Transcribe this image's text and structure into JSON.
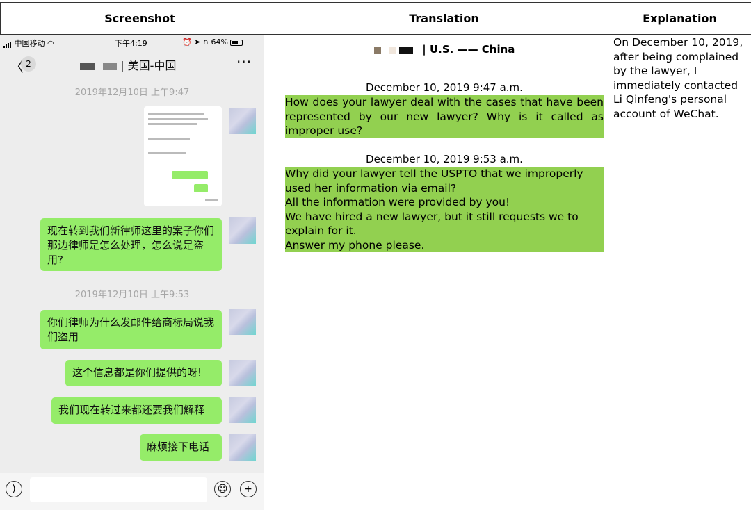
{
  "headers": {
    "screenshot": "Screenshot",
    "translation": "Translation",
    "explanation": "Explanation"
  },
  "phone": {
    "carrier": "中国移动",
    "time": "下午4:19",
    "battery": "64%",
    "back_count": "2",
    "chat_title": "| 美国-中国",
    "more": "···",
    "timestamp1": "2019年12月10日 上午9:47",
    "timestamp2": "2019年12月10日 上午9:53",
    "messages": [
      "现在转到我们新律师这里的案子你们那边律师是怎么处理，怎么说是盗用?",
      "你们律师为什么发邮件给商标局说我们盗用",
      "这个信息都是你们提供的呀!",
      "我们现在转过来都还要我们解释",
      "麻烦接下电话"
    ]
  },
  "translation": {
    "title": "| U.S. —— China",
    "date1": "December 10, 2019    9:47 a.m.",
    "block1": "How does your lawyer deal with the cases that have been represented by our new lawyer? Why is it called as improper use?",
    "date2": "December 10, 2019    9:53 a.m.",
    "block2_lines": [
      "Why did your lawyer tell the USPTO that we improperly used her information via email?",
      "All the information were provided by you!",
      "We have hired a new lawyer, but it still requests we to explain for it.",
      "Answer my phone please."
    ]
  },
  "explanation": "On December 10, 2019, after being complained by the lawyer, I immediately contacted Li Qinfeng's personal account of WeChat.",
  "colors": {
    "bubble": "#95ec69",
    "highlight": "#92d050",
    "chat_bg": "#ededed"
  }
}
